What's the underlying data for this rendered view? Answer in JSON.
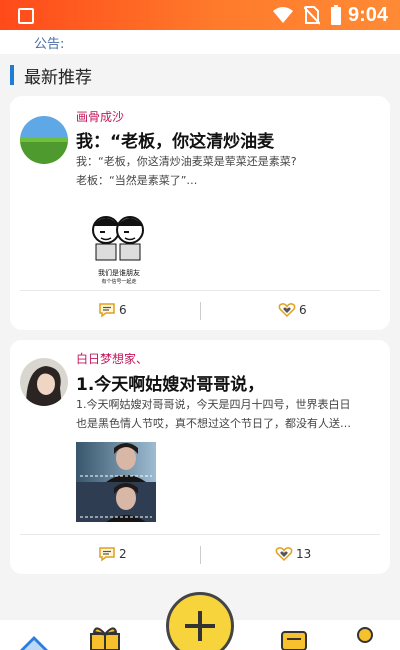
{
  "status_bar": {
    "time": "9:04"
  },
  "notice": {
    "label": "公告:"
  },
  "section": {
    "title": "最新推荐"
  },
  "posts": [
    {
      "author": "画骨成沙",
      "title": "我：“老板，你这清炒油麦",
      "lines": [
        "我：“老板，你这清炒油麦菜是荤菜还是素菜?",
        "老板：“当然是素菜了”…"
      ],
      "image_caption": [
        "我们是谁朋友",
        "有个信号一起走"
      ],
      "comments": "6",
      "likes": "6"
    },
    {
      "author": "白日梦想家、",
      "title": "1.今天啊姑嫂对哥哥说，",
      "lines": [
        "1.今天啊姑嫂对哥哥说，今天是四月十四号，世界表白日",
        "也是黑色情人节哎，真不想过这个节日了，都没有人送…"
      ],
      "comments": "2",
      "likes": "13"
    }
  ],
  "colors": {
    "accent": "#1e7bd6",
    "author": "#c2185b",
    "fab": "#f7d43b",
    "statusbar": "#ff5a1f"
  }
}
